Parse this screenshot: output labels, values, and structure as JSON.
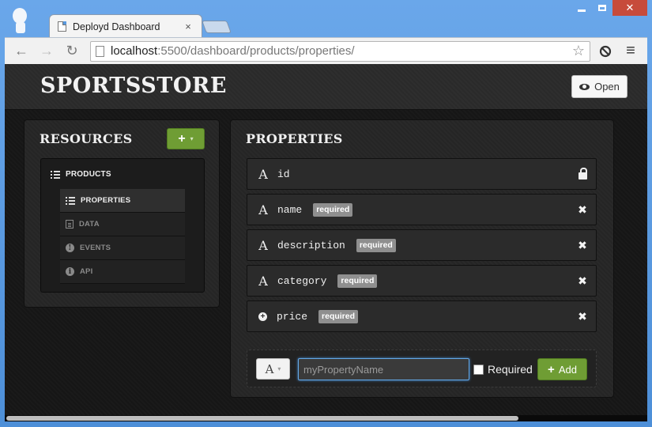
{
  "browser": {
    "tab_title": "Deployd Dashboard",
    "tab_close": "×",
    "url_host": "localhost",
    "url_rest": ":5500/dashboard/products/properties/",
    "nav_back": "←",
    "nav_forward": "→",
    "reload": "↻",
    "star": "☆",
    "menu": "≡",
    "close_glyph": "✕"
  },
  "header": {
    "brand": "SPORTSSTORE",
    "open_label": "Open"
  },
  "resources": {
    "title": "RESOURCES",
    "add_label": "+",
    "root": "PRODUCTS",
    "children": [
      {
        "label": "PROPERTIES",
        "icon": "list-icon",
        "active": true
      },
      {
        "label": "DATA",
        "icon": "document-icon",
        "active": false
      },
      {
        "label": "EVENTS",
        "icon": "exclamation-icon",
        "active": false
      },
      {
        "label": "API",
        "icon": "info-icon",
        "active": false
      }
    ]
  },
  "properties": {
    "title": "PROPERTIES",
    "rows": [
      {
        "type": "A",
        "name": "id",
        "badge": "",
        "action": "lock"
      },
      {
        "type": "A",
        "name": "name",
        "badge": "required",
        "action": "delete"
      },
      {
        "type": "A",
        "name": "description",
        "badge": "required",
        "action": "delete"
      },
      {
        "type": "A",
        "name": "category",
        "badge": "required",
        "action": "delete"
      },
      {
        "type": "+",
        "name": "price",
        "badge": "required",
        "action": "delete"
      }
    ],
    "delete_glyph": "✖",
    "new_row": {
      "type_label": "A",
      "caret": "▾",
      "placeholder": "myPropertyName",
      "required_label": "Required",
      "add_plus": "+",
      "add_label": "Add"
    }
  },
  "colors": {
    "accent_green": "#6f9d34",
    "badge_gray": "#8f8f8f",
    "focus_blue": "#64a9e8"
  }
}
